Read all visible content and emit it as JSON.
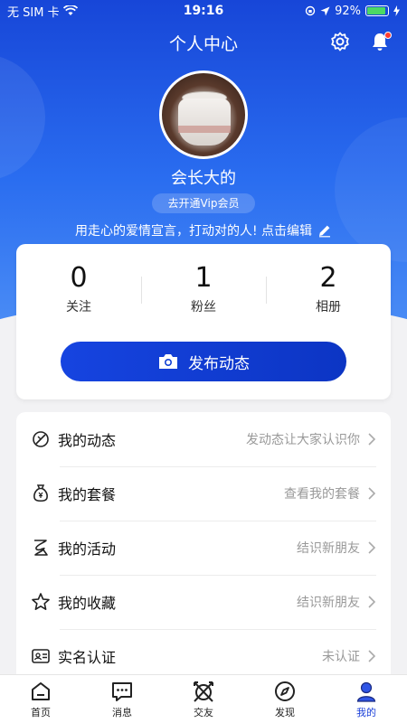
{
  "status_bar": {
    "carrier": "无 SIM 卡",
    "time": "19:16",
    "battery": "92%",
    "battery_level": 0.92
  },
  "nav": {
    "title": "个人中心"
  },
  "profile": {
    "username": "会长大的",
    "vip_label": "去开通Vip会员",
    "motto": "用走心的爱情宣言，打动对的人! 点击编辑"
  },
  "stats": [
    {
      "value": "0",
      "label": "关注"
    },
    {
      "value": "1",
      "label": "粉丝"
    },
    {
      "value": "2",
      "label": "相册"
    }
  ],
  "publish_button": "发布动态",
  "menu": [
    {
      "label": "我的动态",
      "hint": "发动态让大家认识你",
      "icon": "dynamic-icon"
    },
    {
      "label": "我的套餐",
      "hint": "查看我的套餐",
      "icon": "money-bag-icon"
    },
    {
      "label": "我的活动",
      "hint": "结识新朋友",
      "icon": "activity-icon"
    },
    {
      "label": "我的收藏",
      "hint": "结识新朋友",
      "icon": "star-icon"
    },
    {
      "label": "实名认证",
      "hint": "未认证",
      "icon": "id-card-icon"
    }
  ],
  "tabs": [
    {
      "label": "首页",
      "icon": "home-icon"
    },
    {
      "label": "消息",
      "icon": "message-icon"
    },
    {
      "label": "交友",
      "icon": "friends-icon"
    },
    {
      "label": "发现",
      "icon": "compass-icon"
    },
    {
      "label": "我的",
      "icon": "user-icon",
      "active": true
    }
  ],
  "colors": {
    "primary": "#1a3fd8",
    "header_top": "#1746d8",
    "header_bottom": "#4a8cf5",
    "hint_text": "#999999",
    "notification_dot": "#ff3b30"
  }
}
